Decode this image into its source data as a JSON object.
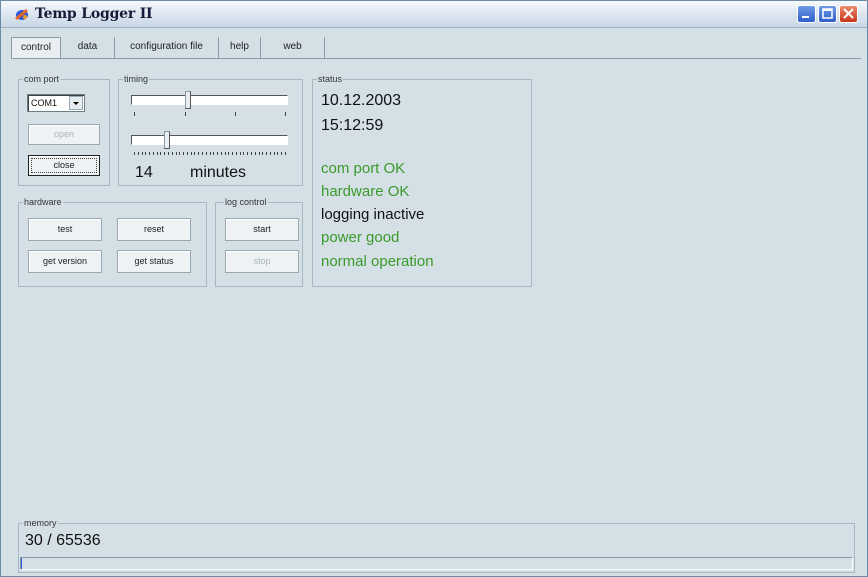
{
  "window": {
    "title": "Temp Logger II"
  },
  "tabs": [
    {
      "label": "control",
      "active": true
    },
    {
      "label": "data",
      "active": false
    },
    {
      "label": "configuration file",
      "active": false
    },
    {
      "label": "help",
      "active": false
    },
    {
      "label": "web",
      "active": false
    }
  ],
  "com_port": {
    "label": "com port",
    "selected": "COM1",
    "open_label": "open",
    "close_label": "close"
  },
  "timing": {
    "label": "timing",
    "slider1_level": 0.36,
    "slider2_level": 0.22,
    "value": "14",
    "unit": "minutes"
  },
  "hardware": {
    "label": "hardware",
    "test_label": "test",
    "reset_label": "reset",
    "get_version_label": "get version",
    "get_status_label": "get status"
  },
  "log_control": {
    "label": "log control",
    "start_label": "start",
    "stop_label": "stop"
  },
  "status": {
    "label": "status",
    "date": "10.12.2003",
    "time": "15:12:59",
    "lines": [
      {
        "text": "com port OK",
        "color": "#3a9a2a"
      },
      {
        "text": "hardware OK",
        "color": "#3a9a2a"
      },
      {
        "text": "logging inactive",
        "color": "#111111"
      },
      {
        "text": "power good",
        "color": "#3a9a2a"
      },
      {
        "text": "normal operation",
        "color": "#3a9a2a"
      }
    ]
  },
  "memory": {
    "label": "memory",
    "value": "30 / 65536",
    "used": 30,
    "total": 65536
  },
  "colors": {
    "ok_green": "#3a9a2a",
    "background": "#d4e0e6"
  }
}
